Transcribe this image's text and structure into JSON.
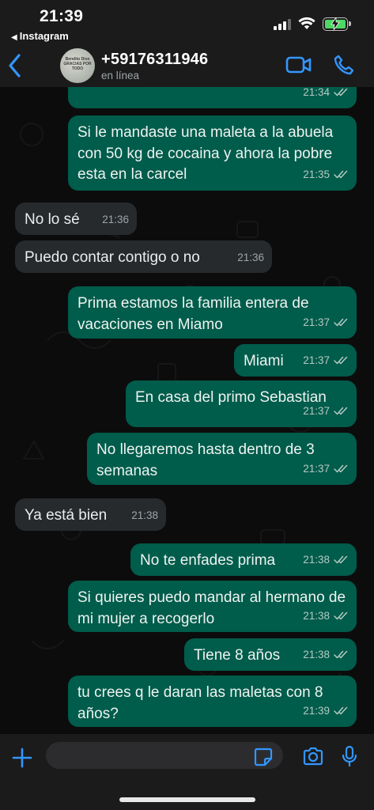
{
  "status_bar": {
    "time": "21:39",
    "back_app": "Instagram"
  },
  "header": {
    "contact_name": "+59176311946",
    "contact_status": "en línea",
    "avatar_text": "Bendito Dios GRACIAS POR TODO"
  },
  "messages": [
    {
      "dir": "out",
      "text": "",
      "time": "21:34"
    },
    {
      "dir": "out",
      "text": "Si le mandaste una maleta a la abuela con 50 kg de cocaina y ahora la pobre esta en la carcel",
      "time": "21:35"
    },
    {
      "dir": "in",
      "text": "No lo sé",
      "time": "21:36"
    },
    {
      "dir": "in",
      "text": "Puedo contar contigo o no",
      "time": "21:36"
    },
    {
      "dir": "out",
      "text": "Prima estamos la familia entera de vacaciones en Miamo",
      "time": "21:37"
    },
    {
      "dir": "out",
      "text": "Miami",
      "time": "21:37"
    },
    {
      "dir": "out",
      "text": "En casa del primo Sebastian",
      "time": "21:37"
    },
    {
      "dir": "out",
      "text": "No llegaremos hasta dentro de 3 semanas",
      "time": "21:37"
    },
    {
      "dir": "in",
      "text": "Ya está bien",
      "time": "21:38"
    },
    {
      "dir": "out",
      "text": "No te enfades prima",
      "time": "21:38"
    },
    {
      "dir": "out",
      "text": "Si quieres puedo mandar al hermano de mi mujer a recogerlo",
      "time": "21:38"
    },
    {
      "dir": "out",
      "text": "Tiene 8 años",
      "time": "21:38"
    },
    {
      "dir": "out",
      "text": "tu crees q le daran las maletas con 8 años?",
      "time": "21:39"
    }
  ],
  "compose": {
    "placeholder": ""
  },
  "colors": {
    "outgoing": "#005c4b",
    "incoming": "#262a2c",
    "accent": "#3396ff"
  },
  "icons": [
    "back-chevron-icon",
    "video-call-icon",
    "phone-call-icon",
    "plus-icon",
    "sticker-icon",
    "camera-icon",
    "microphone-icon",
    "double-check-icon"
  ]
}
